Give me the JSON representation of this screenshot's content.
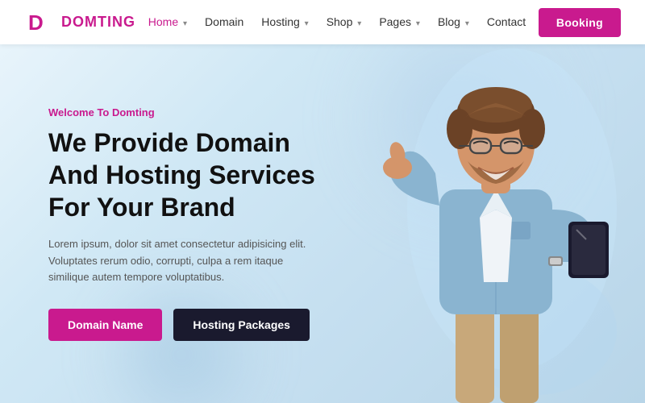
{
  "logo": {
    "text": "DOMTING"
  },
  "navbar": {
    "links": [
      {
        "label": "Home",
        "active": true,
        "hasDropdown": true
      },
      {
        "label": "Domain",
        "active": false,
        "hasDropdown": false
      },
      {
        "label": "Hosting",
        "active": false,
        "hasDropdown": true
      },
      {
        "label": "Shop",
        "active": false,
        "hasDropdown": true
      },
      {
        "label": "Pages",
        "active": false,
        "hasDropdown": true
      },
      {
        "label": "Blog",
        "active": false,
        "hasDropdown": true
      },
      {
        "label": "Contact",
        "active": false,
        "hasDropdown": false
      }
    ],
    "booking_label": "Booking"
  },
  "hero": {
    "welcome_label": "Welcome To Domting",
    "title_line1": "We Provide Domain",
    "title_line2": "And Hosting Services",
    "title_line3": "For Your Brand",
    "description": "Lorem ipsum, dolor sit amet consectetur adipisicing elit. Voluptates rerum odio, corrupti, culpa a rem itaque similique autem tempore voluptatibus.",
    "btn_domain": "Domain Name",
    "btn_hosting": "Hosting Packages"
  },
  "colors": {
    "brand_pink": "#c91a8e",
    "brand_dark": "#1a1a2e",
    "text_dark": "#111111",
    "text_muted": "#555555"
  }
}
